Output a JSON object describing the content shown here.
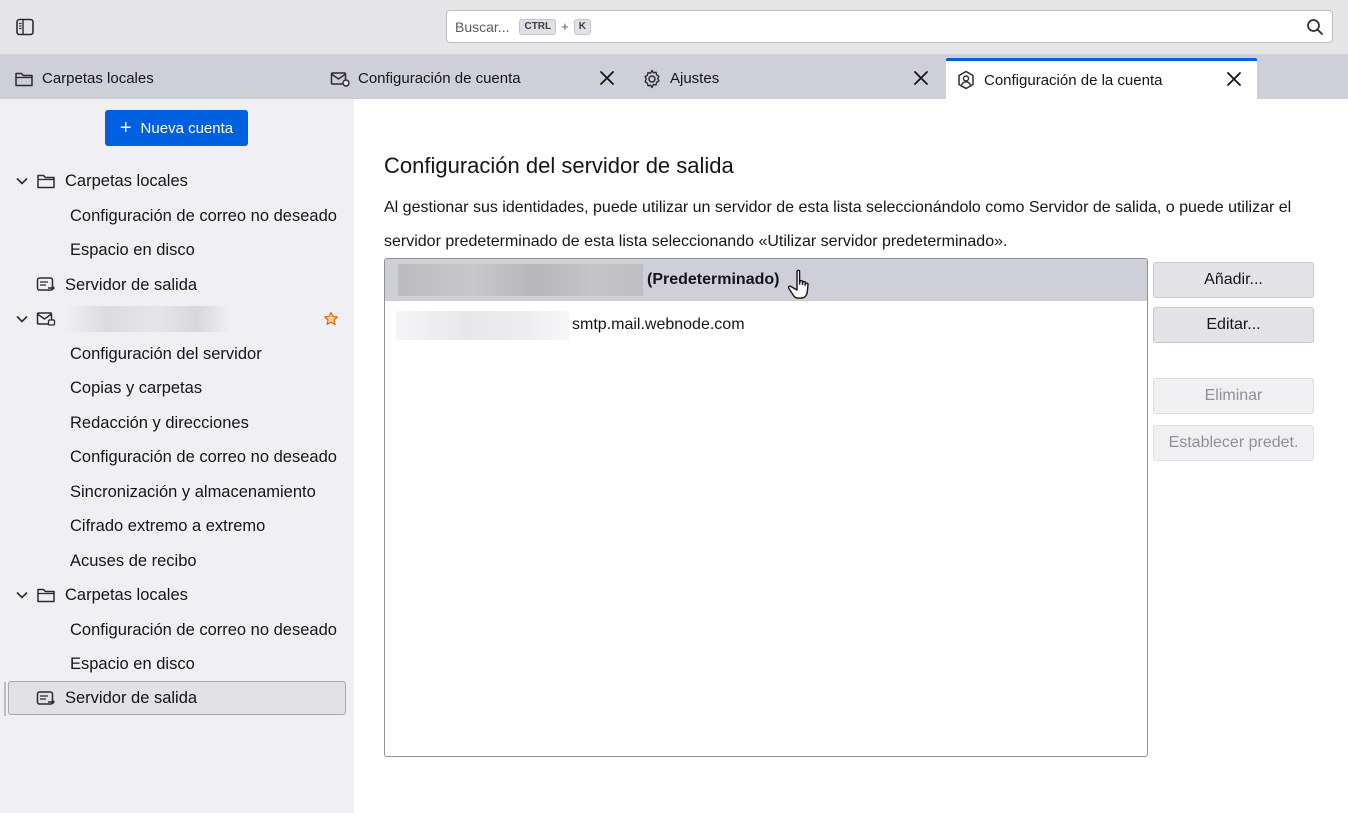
{
  "toolbar": {
    "search": {
      "placeholder": "Buscar...",
      "key1": "CTRL",
      "plus": "+",
      "key2": "K"
    }
  },
  "tabs": [
    {
      "label": "Carpetas locales",
      "icon": "folder-icon",
      "closable": false,
      "selected": false
    },
    {
      "label": "Configuración de cuenta",
      "icon": "mail-settings-icon",
      "closable": true,
      "selected": false
    },
    {
      "label": "Ajustes",
      "icon": "gear-icon",
      "closable": true,
      "selected": false
    },
    {
      "label": "Configuración de la cuenta",
      "icon": "account-shield-icon",
      "closable": true,
      "selected": true
    }
  ],
  "sidebar": {
    "new_account_label": "Nueva cuenta",
    "items": [
      {
        "label": "Carpetas locales",
        "level": 0,
        "icon": "folder-icon",
        "expanded": true
      },
      {
        "label": "Configuración de correo no deseado",
        "level": 1
      },
      {
        "label": "Espacio en disco",
        "level": 1
      },
      {
        "label": "Servidor de salida",
        "level": 0,
        "icon": "outgoing-server-icon"
      },
      {
        "label": "",
        "level": 0,
        "icon": "mail-account-icon",
        "expanded": true,
        "default_account": true
      },
      {
        "label": "Configuración del servidor",
        "level": 1
      },
      {
        "label": "Copias y carpetas",
        "level": 1
      },
      {
        "label": "Redacción y direcciones",
        "level": 1
      },
      {
        "label": "Configuración de correo no deseado",
        "level": 1
      },
      {
        "label": "Sincronización y almacenamiento",
        "level": 1
      },
      {
        "label": "Cifrado extremo a extremo",
        "level": 1
      },
      {
        "label": "Acuses de recibo",
        "level": 1
      },
      {
        "label": "Carpetas locales",
        "level": 0,
        "icon": "folder-icon",
        "expanded": true
      },
      {
        "label": "Configuración de correo no deseado",
        "level": 1
      },
      {
        "label": "Espacio en disco",
        "level": 1
      },
      {
        "label": "Servidor de salida",
        "level": 0,
        "icon": "outgoing-server-icon",
        "selected": true
      }
    ]
  },
  "main": {
    "heading": "Configuración del servidor de salida",
    "description": "Al gestionar sus identidades, puede utilizar un servidor de esta lista seleccionándolo como Servidor de salida, o puede utilizar el servidor predeterminado de esta lista seleccionando «Utilizar servidor predeterminado».",
    "servers": [
      {
        "name_suffix": "(Predeterminado)",
        "selected": true
      },
      {
        "name_suffix": "smtp.mail.webnode.com",
        "selected": false
      }
    ],
    "buttons": {
      "add": "Añadir...",
      "edit": "Editar...",
      "delete": "Eliminar",
      "set_default": "Establecer predet."
    },
    "accent_color": "#0061e0"
  }
}
